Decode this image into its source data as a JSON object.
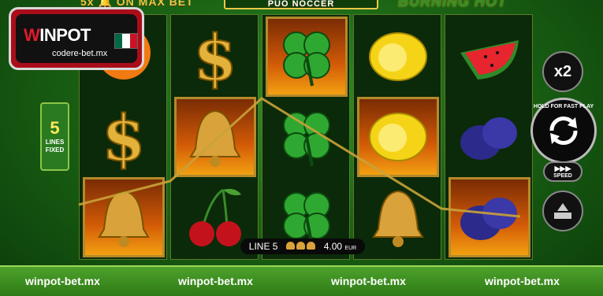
{
  "top_bar": {
    "left_text": "5x 🔔 ON MAX BET",
    "center_text": "PUO NOCCER",
    "right_text": "BURNING HOT"
  },
  "logo": {
    "brand": "WINPOT",
    "brand_w": "W",
    "brand_rest": "INPOT",
    "domain": "codere-bet.mx"
  },
  "lines_badge": {
    "count": "5",
    "label_1": "LINES",
    "label_2": "FIXED"
  },
  "reels": [
    [
      "orange",
      "dollar",
      "bell"
    ],
    [
      "dollar",
      "bell",
      "cherries"
    ],
    [
      "clover",
      "clover",
      "clover"
    ],
    [
      "lemon",
      "lemon",
      "bell"
    ],
    [
      "watermelon",
      "plum",
      "plum"
    ]
  ],
  "winning_cells": [
    [
      0,
      2
    ],
    [
      1,
      1
    ],
    [
      2,
      0
    ],
    [
      3,
      1
    ],
    [
      4,
      2
    ]
  ],
  "win_info": {
    "line_label": "LINE 5",
    "amount": "4.00",
    "currency": "EUR"
  },
  "side_buttons": {
    "multiplier": "x2",
    "spin_label": "HOLD FOR FAST PLAY",
    "speed_label": "SPEED"
  },
  "footer_links": [
    "winpot-bet.mx",
    "winpot-bet.mx",
    "winpot-bet.mx",
    "winpot-bet.mx"
  ],
  "colors": {
    "accent_gold": "#e8c84a",
    "win_frame": "#b48a2a",
    "background": "#1a6314",
    "logo_red": "#a90d1a"
  }
}
